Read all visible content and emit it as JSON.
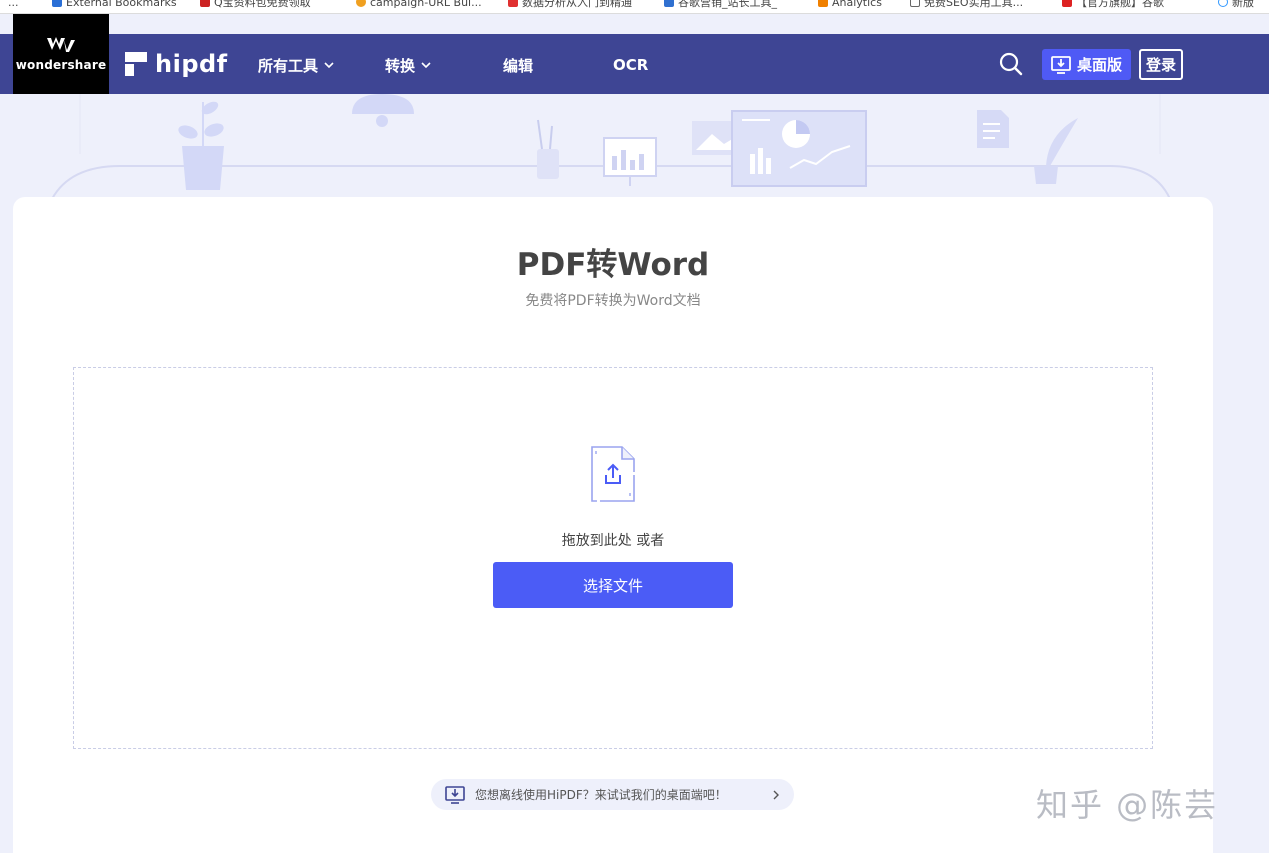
{
  "bookmarks": [
    {
      "label": "External Bookmarks",
      "color": "#2a6fd6"
    },
    {
      "label": "Q宝资料包免费领取",
      "color": "#cc2222"
    },
    {
      "label": "campaign-URL Bui...",
      "color": "#f0a020"
    },
    {
      "label": "数据分析从入门到精通",
      "color": "#e03030"
    },
    {
      "label": "谷歌营销_站长工具_",
      "color": "#3070d0"
    },
    {
      "label": "Analytics",
      "color": "#f08000"
    },
    {
      "label": "免费SEO实用工具...",
      "color": "#666666"
    },
    {
      "label": "【官方旗舰】谷歌",
      "color": "#dd2222"
    },
    {
      "label": "新版",
      "color": "#3399ff"
    }
  ],
  "brand": {
    "wondershare": "wondershare",
    "hipdf": "hipdf"
  },
  "nav": {
    "all_tools": "所有工具",
    "convert": "转换",
    "edit": "编辑",
    "ocr": "OCR",
    "desktop": "桌面版",
    "login": "登录"
  },
  "main": {
    "title": "PDF转Word",
    "subtitle": "免费将PDF转换为Word文档",
    "drop_text": "拖放到此处 或者",
    "choose_button": "选择文件",
    "offline_tip": "您想离线使用HiPDF？来试试我们的桌面端吧！"
  },
  "watermark": "知乎 @陈芸",
  "colors": {
    "nav_bg": "#3e4594",
    "accent": "#4b5cf6",
    "page_bg": "#eef0fb"
  }
}
